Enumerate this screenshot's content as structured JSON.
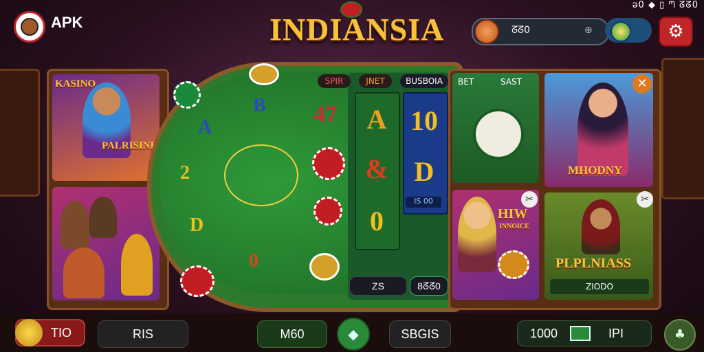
{
  "status_bar": {
    "text": "ǝ0 ◆ ▯ ᘉ ᘔᘔ0"
  },
  "header": {
    "brand": "APK",
    "logo_icon": "avatar-logo-icon",
    "title": "INDIANSIA",
    "coins": "ᘔᘔ0",
    "add_icon": "crosshair-icon",
    "gem_icon": "gem-icon",
    "settings_icon": "gear-icon"
  },
  "games": {
    "casino": {
      "tag": "KASINO",
      "name": "PALRISINE"
    },
    "machine": {
      "tabs": [
        "BET",
        "SAST"
      ]
    },
    "money": {
      "name": "MHODNY"
    },
    "hiw": {
      "name": "HIW",
      "sub": "INNOICE"
    },
    "plpln": {
      "name": "PLPLNIASS",
      "badge": "ZIODO"
    }
  },
  "table": {
    "letters": [
      "B",
      "A",
      "2",
      "D",
      "0"
    ],
    "tabs": [
      "SPIR",
      "JNET",
      "BUSBOIA"
    ],
    "reel1": [
      "A",
      "&",
      "0"
    ],
    "reel2": [
      "10",
      "D"
    ],
    "reel2_value": "IS 00",
    "bet_left": "ZS",
    "bet_right": "8ᘔᘔ0",
    "jackpot": "47"
  },
  "bottom": {
    "b1": "TIO",
    "b2": "RIS",
    "b3": "M60",
    "b4": "SBGIS",
    "b5": "1000",
    "b6": "IPI",
    "b6_icon": "cash-icon",
    "b7_icon": "cards-icon"
  },
  "colors": {
    "accent": "#f7c23a",
    "red": "#c02528",
    "felt": "#2d7a2d"
  }
}
